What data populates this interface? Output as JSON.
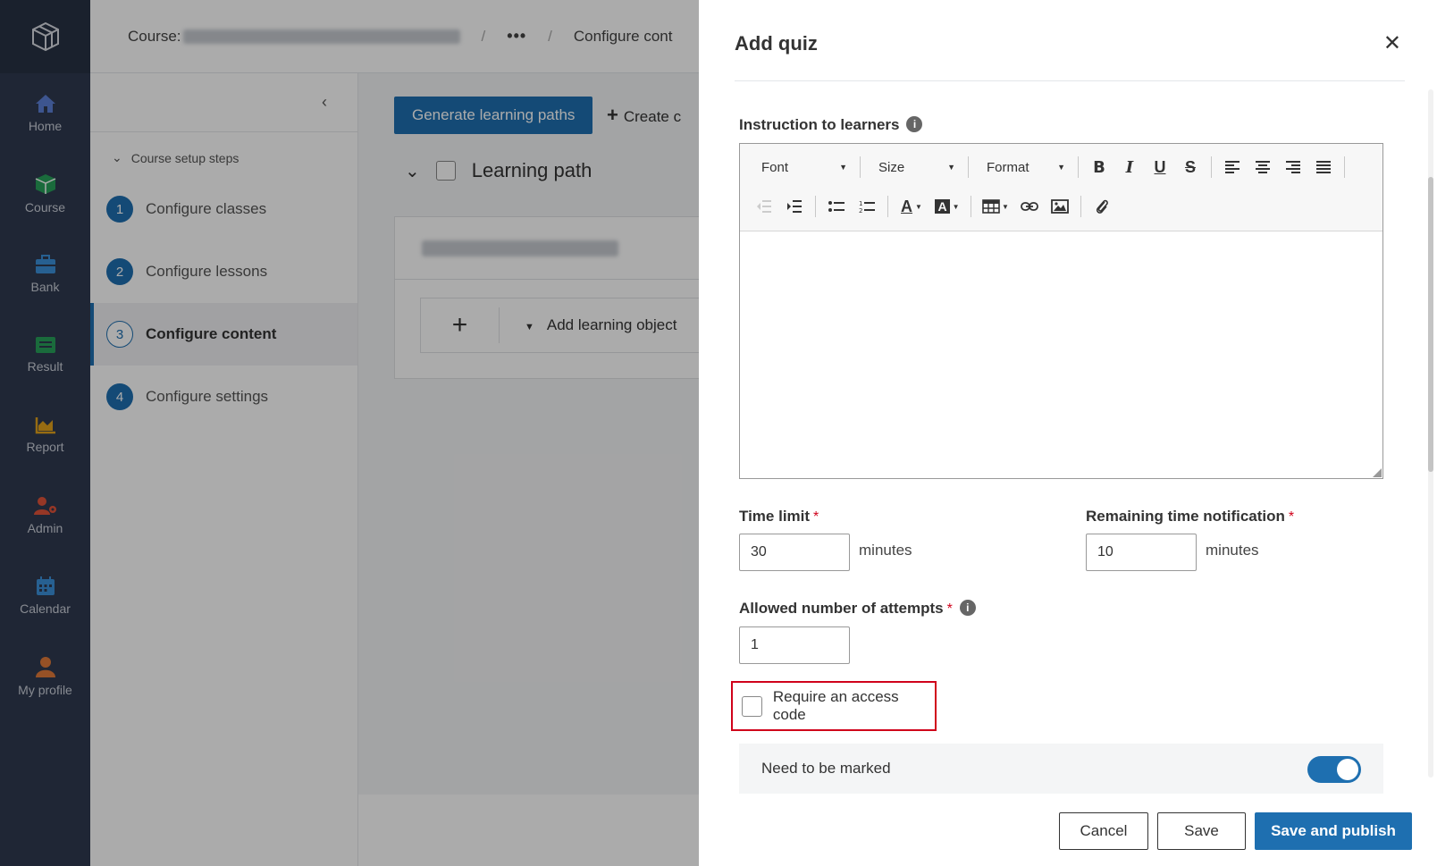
{
  "nav": {
    "items": [
      {
        "label": "Home",
        "icon": "home-icon",
        "color": "#5b7fd6"
      },
      {
        "label": "Course",
        "icon": "course-icon",
        "color": "#27a05a"
      },
      {
        "label": "Bank",
        "icon": "bank-icon",
        "color": "#3b8fd9"
      },
      {
        "label": "Result",
        "icon": "result-icon",
        "color": "#27a05a"
      },
      {
        "label": "Report",
        "icon": "report-icon",
        "color": "#e2a21c"
      },
      {
        "label": "Admin",
        "icon": "admin-icon",
        "color": "#e0533a"
      },
      {
        "label": "Calendar",
        "icon": "calendar-icon",
        "color": "#3b8fd9"
      },
      {
        "label": "My profile",
        "icon": "profile-icon",
        "color": "#e07a3a"
      }
    ]
  },
  "breadcrumb": {
    "course_prefix": "Course:",
    "more": "•••",
    "current": "Configure cont"
  },
  "steps": {
    "title": "Course setup steps",
    "items": [
      {
        "num": "1",
        "label": "Configure classes"
      },
      {
        "num": "2",
        "label": "Configure lessons"
      },
      {
        "num": "3",
        "label": "Configure content"
      },
      {
        "num": "4",
        "label": "Configure settings"
      }
    ]
  },
  "content": {
    "generate_label": "Generate learning paths",
    "create_label": "Create c",
    "learning_path_label": "Learning path",
    "add_lo_label": "Add learning object"
  },
  "drawer": {
    "title": "Add quiz",
    "instruction_label": "Instruction to learners",
    "toolbar": {
      "font": "Font",
      "size": "Size",
      "format": "Format"
    },
    "time_limit": {
      "label": "Time limit",
      "value": "30",
      "unit": "minutes"
    },
    "remaining": {
      "label": "Remaining time notification",
      "value": "10",
      "unit": "minutes"
    },
    "attempts": {
      "label": "Allowed number of attempts",
      "value": "1"
    },
    "access_code_label": "Require an access code",
    "need_marked_label": "Need to be marked",
    "need_marked_on": true,
    "buttons": {
      "cancel": "Cancel",
      "save": "Save",
      "publish": "Save and publish"
    }
  },
  "colors": {
    "primary": "#1e6fb0",
    "nav_bg": "#2f3a4f",
    "required": "#d0021b"
  }
}
